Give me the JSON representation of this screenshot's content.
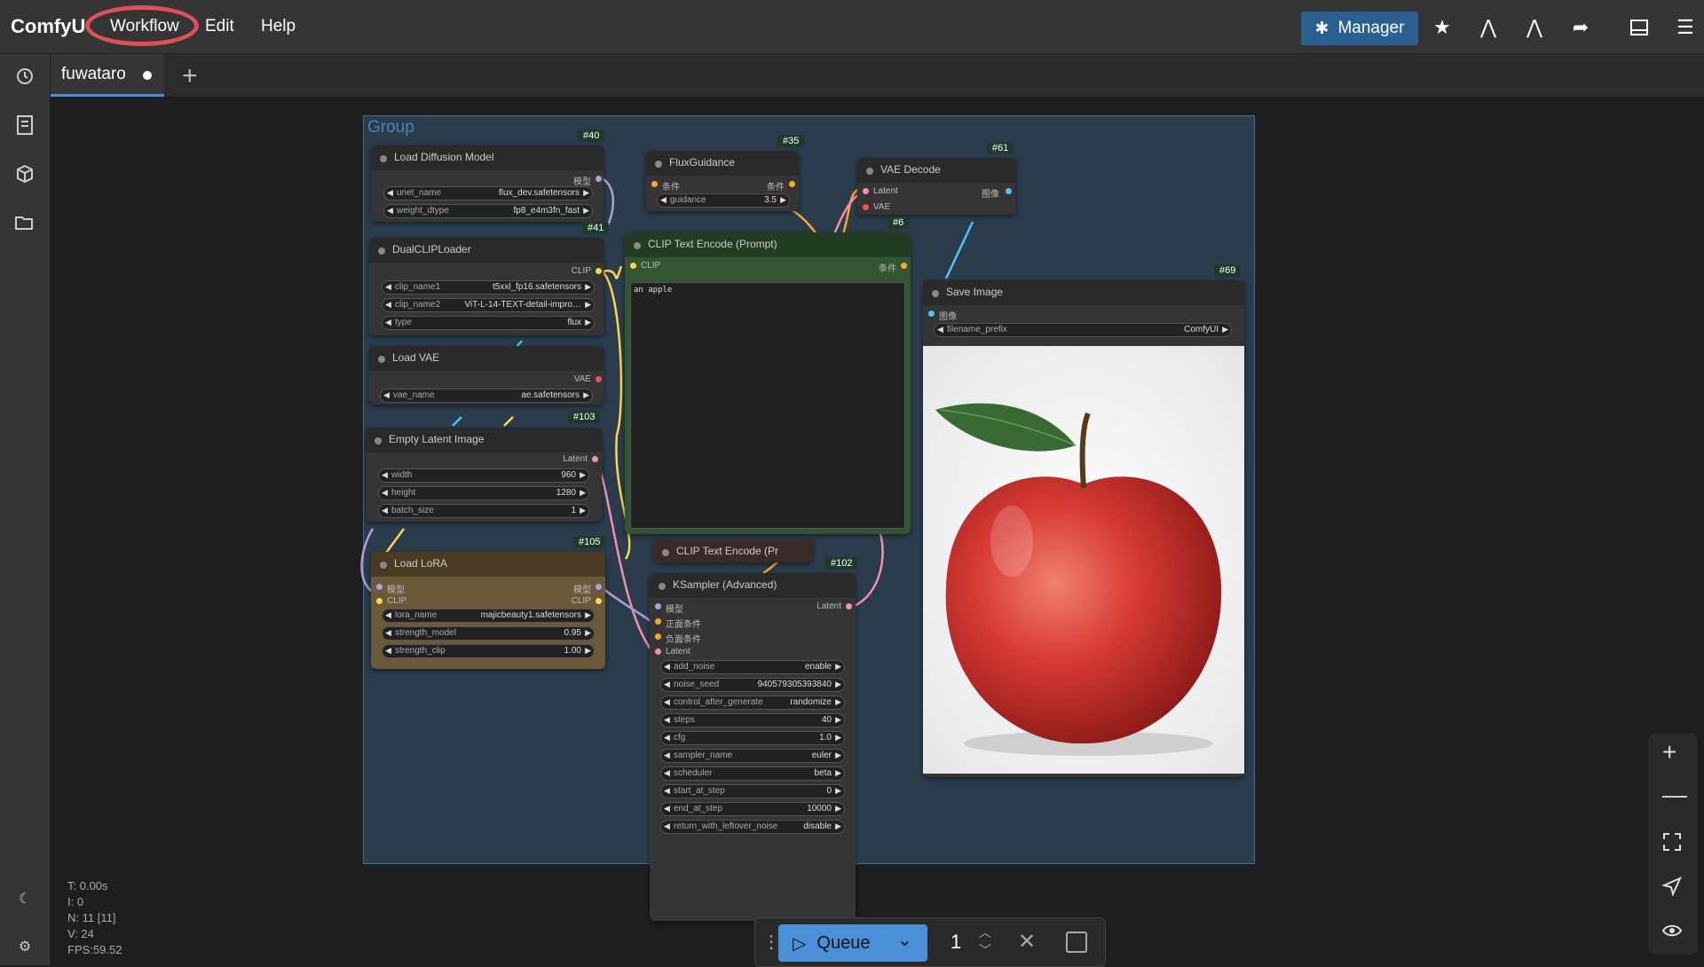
{
  "app": {
    "logo": "ComfyU"
  },
  "menu": [
    {
      "label": "Workflow"
    },
    {
      "label": "Edit"
    },
    {
      "label": "Help"
    }
  ],
  "toolbar": {
    "manager_label": "Manager"
  },
  "tabs": [
    {
      "label": "fuwataro"
    }
  ],
  "group": {
    "title": "Group"
  },
  "nodes": {
    "load_diffusion": {
      "id": "#40",
      "title": "Load Diffusion Model",
      "output": "模型",
      "widgets": [
        {
          "name": "unet_name",
          "value": "flux_dev.safetensors"
        },
        {
          "name": "weight_dtype",
          "value": "fp8_e4m3fn_fast"
        }
      ]
    },
    "dual_clip": {
      "id": "#41",
      "title": "DualCLIPLoader",
      "output": "CLIP",
      "widgets": [
        {
          "name": "clip_name1",
          "value": "t5xxl_fp16.safetensors"
        },
        {
          "name": "clip_name2",
          "value": "ViT-L-14-TEXT-detail-impro…"
        },
        {
          "name": "type",
          "value": "flux"
        }
      ]
    },
    "load_vae": {
      "title": "Load VAE",
      "output": "VAE",
      "widgets": [
        {
          "name": "vae_name",
          "value": "ae.safetensors"
        }
      ]
    },
    "empty_latent": {
      "id": "#103",
      "title": "Empty Latent Image",
      "output": "Latent",
      "widgets": [
        {
          "name": "width",
          "value": "960"
        },
        {
          "name": "height",
          "value": "1280"
        },
        {
          "name": "batch_size",
          "value": "1"
        }
      ]
    },
    "load_lora": {
      "id": "#105",
      "title": "Load LoRA",
      "inputs": [
        "模型",
        "CLIP"
      ],
      "outputs": [
        "模型",
        "CLIP"
      ],
      "widgets": [
        {
          "name": "lora_name",
          "value": "majicbeauty1.safetensors"
        },
        {
          "name": "strength_model",
          "value": "0.95"
        },
        {
          "name": "strength_clip",
          "value": "1.00"
        }
      ]
    },
    "flux_guidance": {
      "id": "#35",
      "title": "FluxGuidance",
      "input": "条件",
      "output": "条件",
      "widgets": [
        {
          "name": "guidance",
          "value": "3.5"
        }
      ]
    },
    "clip_text_encode": {
      "id": "#6",
      "title": "CLIP Text Encode (Prompt)",
      "input": "CLIP",
      "output": "条件",
      "text": "an apple"
    },
    "clip_text_encode_2": {
      "title": "CLIP Text Encode (Pr"
    },
    "vae_decode": {
      "id": "#61",
      "title": "VAE Decode",
      "inputs": [
        "Latent",
        "VAE"
      ],
      "output": "图像"
    },
    "save_image": {
      "id": "#69",
      "title": "Save Image",
      "input": "图像",
      "widgets": [
        {
          "name": "filename_prefix",
          "value": "ComfyUI"
        }
      ]
    },
    "ksampler": {
      "id": "#102",
      "title": "KSampler (Advanced)",
      "inputs": [
        "模型",
        "正面条件",
        "负面条件",
        "Latent"
      ],
      "output": "Latent",
      "widgets": [
        {
          "name": "add_noise",
          "value": "enable"
        },
        {
          "name": "noise_seed",
          "value": "940579305393840"
        },
        {
          "name": "control_after_generate",
          "value": "randomize"
        },
        {
          "name": "steps",
          "value": "40"
        },
        {
          "name": "cfg",
          "value": "1.0"
        },
        {
          "name": "sampler_name",
          "value": "euler"
        },
        {
          "name": "scheduler",
          "value": "beta"
        },
        {
          "name": "start_at_step",
          "value": "0"
        },
        {
          "name": "end_at_step",
          "value": "10000"
        },
        {
          "name": "return_with_leftover_noise",
          "value": "disable"
        }
      ]
    }
  },
  "stats": {
    "t": "T: 0.00s",
    "i": "I: 0",
    "n": "N: 11 [11]",
    "v": "V: 24",
    "fps": "FPS:59.52"
  },
  "queue": {
    "label": "Queue",
    "count": "1"
  }
}
